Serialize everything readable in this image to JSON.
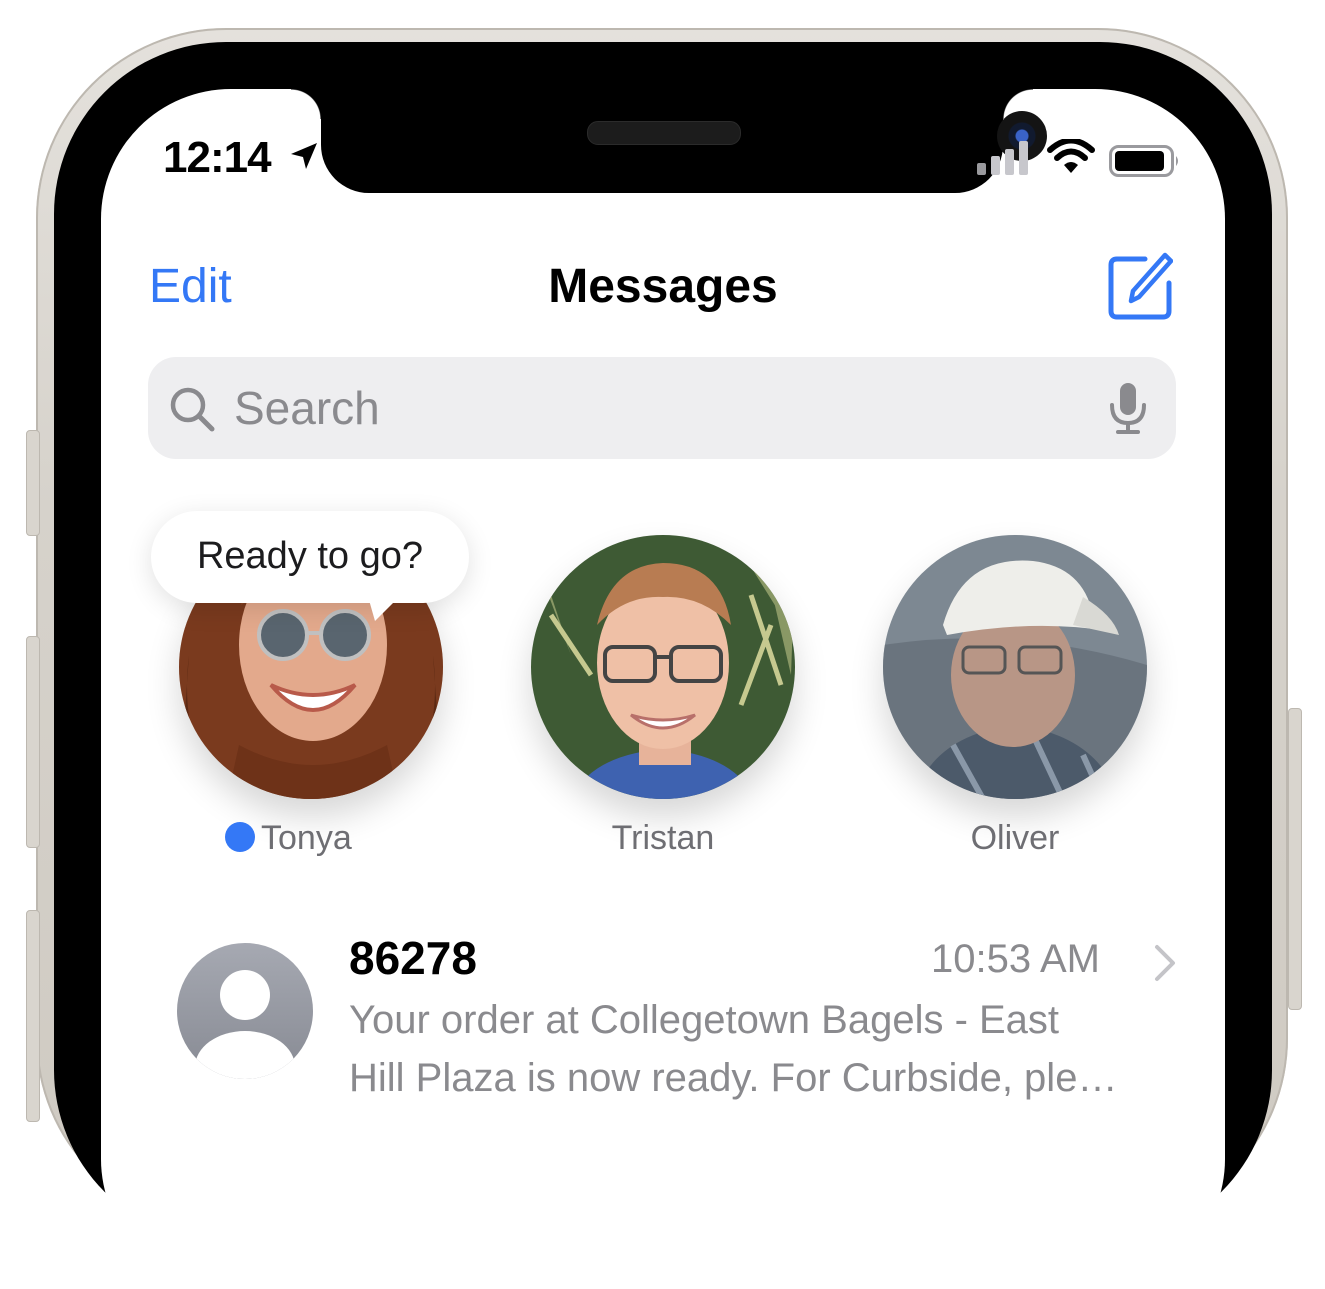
{
  "status_bar": {
    "time": "12:14"
  },
  "nav": {
    "edit_label": "Edit",
    "title": "Messages"
  },
  "search": {
    "placeholder": "Search"
  },
  "pinned": [
    {
      "name": "Tonya",
      "bubble": "Ready to go?",
      "unread": true
    },
    {
      "name": "Tristan"
    },
    {
      "name": "Oliver"
    }
  ],
  "conversations": [
    {
      "sender": "86278",
      "time": "10:53 AM",
      "preview_line1": "Your order at Collegetown Bagels - East",
      "preview_line2": "Hill Plaza is now ready. For Curbside, ple…"
    }
  ],
  "colors": {
    "accent": "#3478f6",
    "secondary_text": "#8a8a8e",
    "search_bg": "#eeeef0"
  }
}
